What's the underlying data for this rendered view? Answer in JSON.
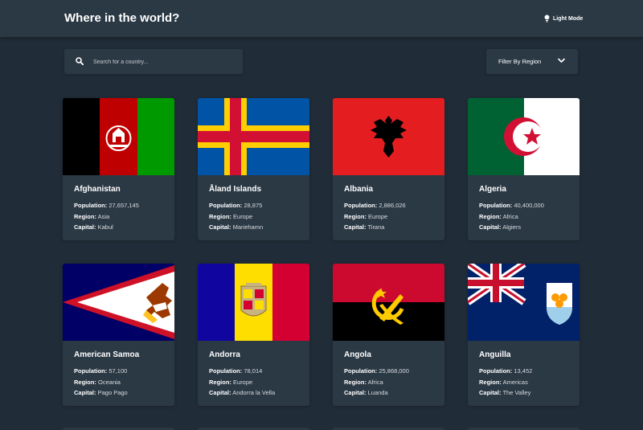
{
  "header": {
    "title": "Where in the world?",
    "mode_label": "Light Mode"
  },
  "search": {
    "placeholder": "Search for a country..."
  },
  "filter": {
    "label": "Filter By Region"
  },
  "stat_labels": {
    "population": "Population:",
    "region": "Region:",
    "capital": "Capital:"
  },
  "countries": [
    {
      "name": "Afghanistan",
      "population": "27,657,145",
      "region": "Asia",
      "capital": "Kabul",
      "flag": "afghanistan-flag"
    },
    {
      "name": "Åland Islands",
      "population": "28,875",
      "region": "Europe",
      "capital": "Mariehamn",
      "flag": "aland-islands-flag"
    },
    {
      "name": "Albania",
      "population": "2,886,026",
      "region": "Europe",
      "capital": "Tirana",
      "flag": "albania-flag"
    },
    {
      "name": "Algeria",
      "population": "40,400,000",
      "region": "Africa",
      "capital": "Algiers",
      "flag": "algeria-flag"
    },
    {
      "name": "American Samoa",
      "population": "57,100",
      "region": "Oceania",
      "capital": "Pago Pago",
      "flag": "american-samoa-flag"
    },
    {
      "name": "Andorra",
      "population": "78,014",
      "region": "Europe",
      "capital": "Andorra la Vella",
      "flag": "andorra-flag"
    },
    {
      "name": "Angola",
      "population": "25,868,000",
      "region": "Africa",
      "capital": "Luanda",
      "flag": "angola-flag"
    },
    {
      "name": "Anguilla",
      "population": "13,452",
      "region": "Americas",
      "capital": "The Valley",
      "flag": "anguilla-flag"
    }
  ],
  "colors": {
    "background": "#202c37",
    "element": "#2b3945",
    "text": "#ffffff"
  }
}
